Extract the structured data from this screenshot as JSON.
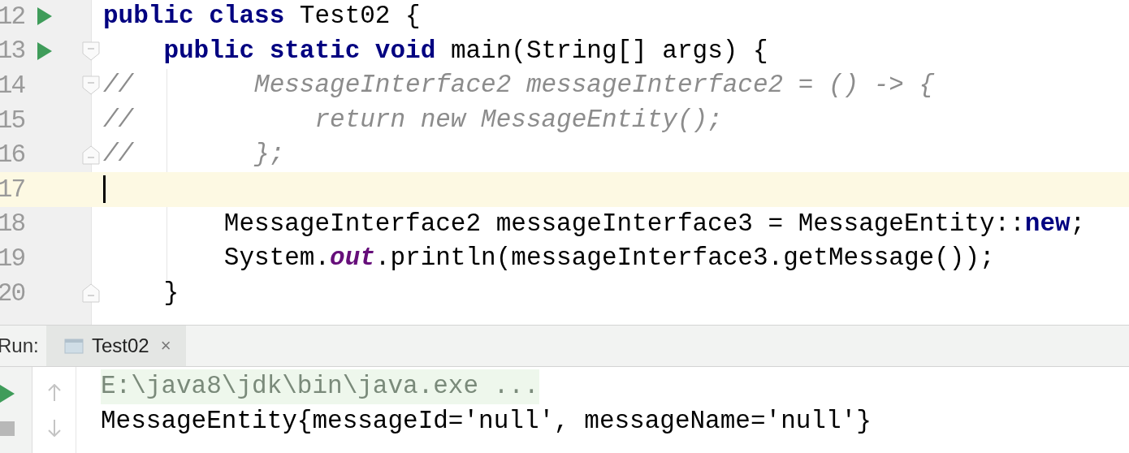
{
  "editor": {
    "lines": [
      {
        "number": "12",
        "run_marker": true,
        "fold_start": false,
        "fold_end": false,
        "current": false,
        "caret": false,
        "tokens": [
          {
            "kind": "keyword",
            "text": "public class"
          },
          {
            "kind": "plain",
            "text": " Test02 {"
          }
        ]
      },
      {
        "number": "13",
        "run_marker": true,
        "fold_start": true,
        "fold_end": false,
        "current": false,
        "caret": false,
        "tokens": [
          {
            "kind": "keyword",
            "text": "    public static void"
          },
          {
            "kind": "plain",
            "text": " main(String[] args) {"
          }
        ]
      },
      {
        "number": "14",
        "run_marker": false,
        "fold_start": true,
        "fold_end": false,
        "current": false,
        "caret": false,
        "tokens": [
          {
            "kind": "comment",
            "text": "//        MessageInterface2 messageInterface2 = () -> {"
          }
        ]
      },
      {
        "number": "15",
        "run_marker": false,
        "fold_start": false,
        "fold_end": false,
        "current": false,
        "caret": false,
        "tokens": [
          {
            "kind": "comment",
            "text": "//            return new MessageEntity();"
          }
        ]
      },
      {
        "number": "16",
        "run_marker": false,
        "fold_start": false,
        "fold_end": true,
        "current": false,
        "caret": false,
        "tokens": [
          {
            "kind": "comment",
            "text": "//        };"
          }
        ]
      },
      {
        "number": "17",
        "run_marker": false,
        "fold_start": false,
        "fold_end": false,
        "current": true,
        "caret": true
      },
      {
        "number": "18",
        "run_marker": false,
        "fold_start": false,
        "fold_end": false,
        "current": false,
        "caret": false,
        "tokens": [
          {
            "kind": "plain",
            "text": "        MessageInterface2 messageInterface3 = MessageEntity::"
          },
          {
            "kind": "keyword",
            "text": "new"
          },
          {
            "kind": "plain",
            "text": ";"
          }
        ]
      },
      {
        "number": "19",
        "run_marker": false,
        "fold_start": false,
        "fold_end": false,
        "current": false,
        "caret": false,
        "tokens": [
          {
            "kind": "plain",
            "text": "        System."
          },
          {
            "kind": "static_field",
            "text": "out"
          },
          {
            "kind": "plain",
            "text": ".println(messageInterface3.getMessage());"
          }
        ]
      },
      {
        "number": "20",
        "run_marker": false,
        "fold_start": false,
        "fold_end": true,
        "current": false,
        "caret": false,
        "tokens": [
          {
            "kind": "plain",
            "text": "    }"
          }
        ]
      }
    ]
  },
  "run_panel": {
    "label": "Run:",
    "tabs": [
      {
        "label": "Test02",
        "selected": true,
        "close": "×"
      }
    ],
    "console": [
      {
        "kind": "command",
        "text": "E:\\java8\\jdk\\bin\\java.exe ..."
      },
      {
        "kind": "output",
        "text": "MessageEntity{messageId='null', messageName='null'}"
      }
    ]
  }
}
